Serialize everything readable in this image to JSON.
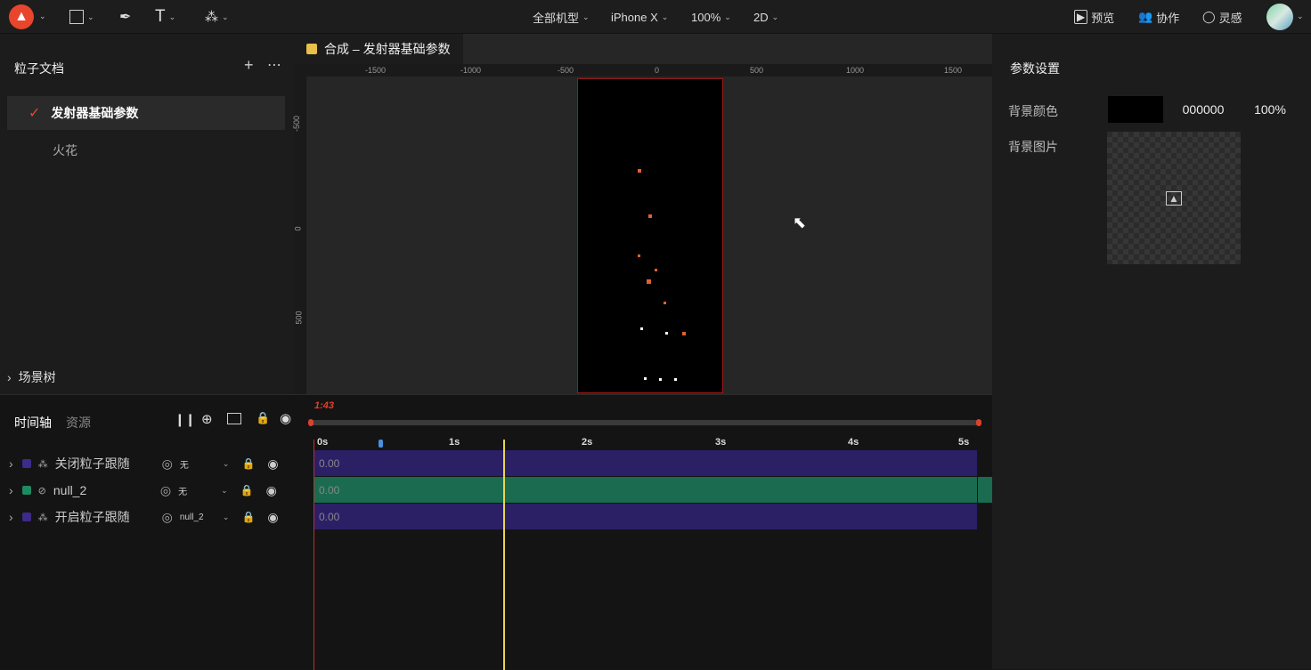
{
  "topbar": {
    "zoom_options": [
      "全部机型",
      "iPhone X",
      "100%",
      "2D"
    ],
    "preview": "预览",
    "collab": "协作",
    "inspire": "灵感"
  },
  "left": {
    "title": "粒子文档",
    "items": [
      "发射器基础参数",
      "火花"
    ],
    "scene_tree": "场景树"
  },
  "canvas": {
    "tab_title": "合成 – 发射器基础参数",
    "ruler_x": [
      "-1500",
      "-1000",
      "-500",
      "0",
      "500",
      "1000",
      "1500"
    ],
    "ruler_y": [
      "-500",
      "0",
      "500"
    ]
  },
  "right": {
    "title": "参数设置",
    "bg_color_label": "背景颜色",
    "bg_color_hex": "000000",
    "bg_opacity": "100%",
    "bg_image_label": "背景图片"
  },
  "timeline": {
    "tabs": [
      "时间轴",
      "资源"
    ],
    "current_time": "1:43",
    "ticks": [
      "0s",
      "1s",
      "2s",
      "3s",
      "4s",
      "5s"
    ],
    "layers": [
      {
        "name": "关闭粒子跟随",
        "parent": "无",
        "value": "0.00",
        "color": "#3d2a8a"
      },
      {
        "name": "null_2",
        "parent": "无",
        "value": "0.00",
        "color": "#1e8a62"
      },
      {
        "name": "开启粒子跟随",
        "parent": "null_2",
        "value": "0.00",
        "color": "#3d2a8a"
      }
    ]
  }
}
